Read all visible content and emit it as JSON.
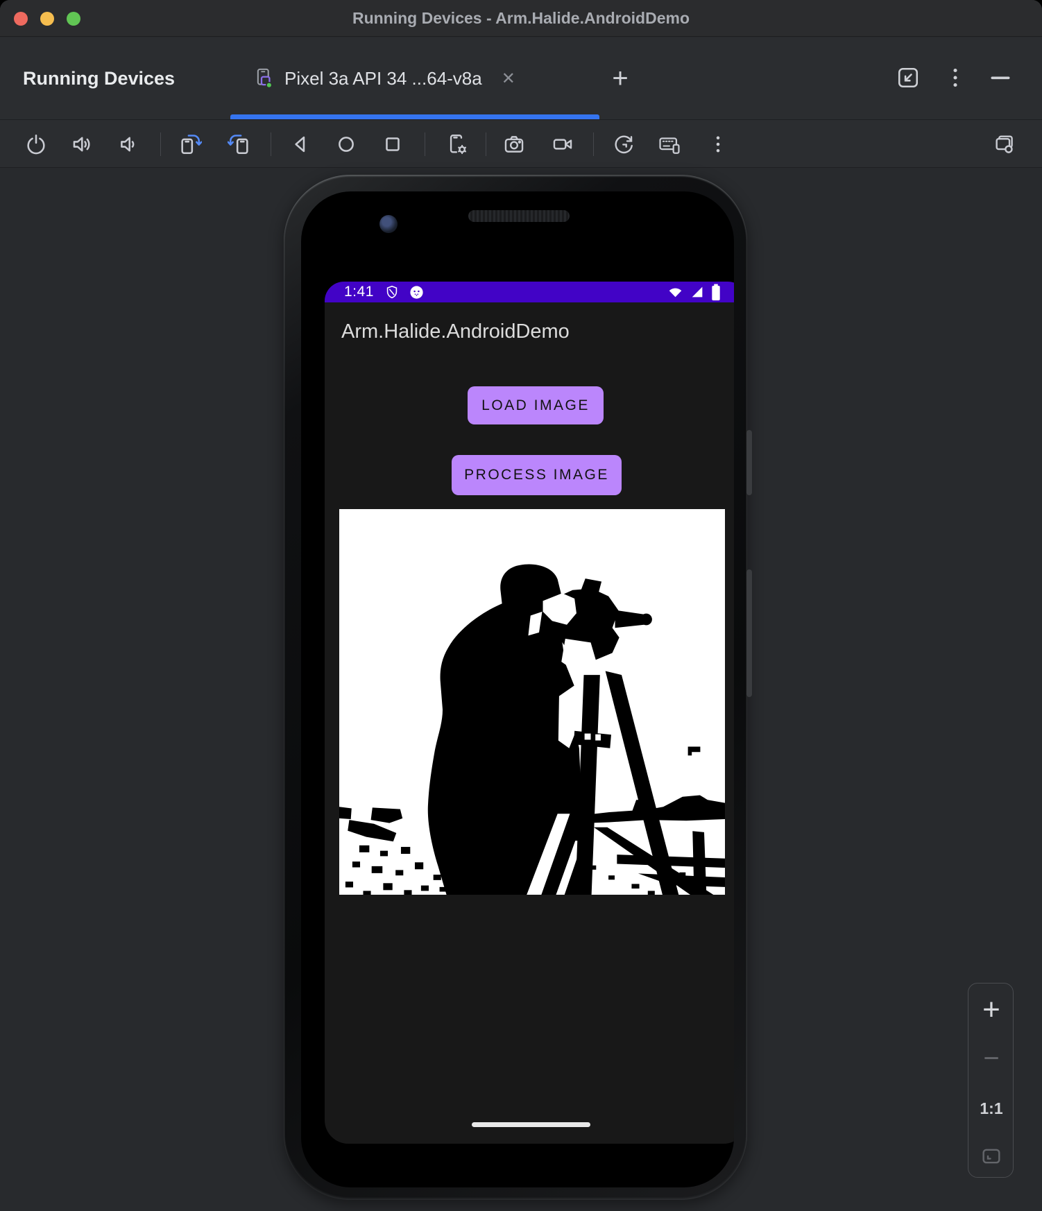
{
  "window": {
    "title": "Running Devices - Arm.Halide.AndroidDemo"
  },
  "tabbar": {
    "panel_title": "Running Devices",
    "tab_label": "Pixel 3a API 34 ...64-v8a",
    "close_glyph": "✕",
    "new_tab_glyph": "+"
  },
  "toolbar": {
    "icon_names": [
      "power",
      "volume-up",
      "volume-down",
      "rotate-clockwise",
      "rotate-counterclockwise",
      "back",
      "home",
      "overview",
      "device-settings",
      "screenshot-camera",
      "screen-record",
      "reset-view",
      "hardware-input",
      "more-options",
      "find-device-window"
    ]
  },
  "device": {
    "status_bar": {
      "time": "1:41"
    },
    "app": {
      "title": "Arm.Halide.AndroidDemo",
      "load_button": "LOAD IMAGE",
      "process_button": "PROCESS IMAGE"
    }
  },
  "zoom_controls": {
    "zoom_in": "+",
    "zoom_out": "−",
    "actual_size": "1:1"
  },
  "colors": {
    "accent_blue": "#3574F0",
    "status_bar_purple": "#4203C6",
    "button_purple": "#BB86FC",
    "icon_gray": "#C9CBD2"
  }
}
